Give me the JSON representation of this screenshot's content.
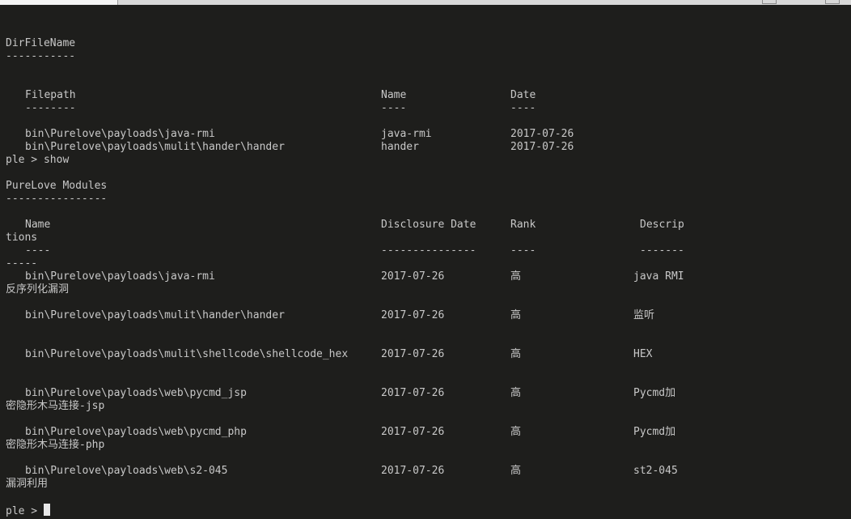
{
  "dirfile": {
    "heading": "DirFileName",
    "underline": "-----------",
    "columns": {
      "filepath": "Filepath",
      "name": "Name",
      "date": "Date"
    },
    "dashes": {
      "filepath": "--------",
      "name": "----",
      "date": "----"
    },
    "rows": [
      {
        "filepath": "bin\\Purelove\\payloads\\java-rmi",
        "name": "java-rmi",
        "date": "2017-07-26"
      },
      {
        "filepath": "bin\\Purelove\\payloads\\mulit\\hander\\hander",
        "name": "hander",
        "date": "2017-07-26"
      }
    ]
  },
  "show_command": "ple > show",
  "modules": {
    "heading": "PureLove Modules",
    "underline": "----------------",
    "columns": {
      "name": "Name",
      "date": "Disclosure Date",
      "rank": "Rank",
      "desc": "Descrip",
      "desc_wrap": "tions"
    },
    "dashes": {
      "name": "----",
      "date": "---------------",
      "rank": "----",
      "desc": "-------",
      "desc_wrap": "-----"
    },
    "rows": [
      {
        "name": "bin\\Purelove\\payloads\\java-rmi",
        "date": "2017-07-26",
        "rank": "高",
        "desc": "java RMI",
        "desc_wrap": "反序列化漏洞"
      },
      {
        "name": "bin\\Purelove\\payloads\\mulit\\hander\\hander",
        "date": "2017-07-26",
        "rank": "高",
        "desc": "监听",
        "desc_wrap": ""
      },
      {
        "name": "bin\\Purelove\\payloads\\mulit\\shellcode\\shellcode_hex",
        "date": "2017-07-26",
        "rank": "高",
        "desc": "HEX",
        "desc_wrap": ""
      },
      {
        "name": "bin\\Purelove\\payloads\\web\\pycmd_jsp",
        "date": "2017-07-26",
        "rank": "高",
        "desc": "Pycmd加",
        "desc_wrap": "密隐形木马连接-jsp"
      },
      {
        "name": "bin\\Purelove\\payloads\\web\\pycmd_php",
        "date": "2017-07-26",
        "rank": "高",
        "desc": "Pycmd加",
        "desc_wrap": "密隐形木马连接-php"
      },
      {
        "name": "bin\\Purelove\\payloads\\web\\s2-045",
        "date": "2017-07-26",
        "rank": "高",
        "desc": "st2-045",
        "desc_wrap": "漏洞利用"
      }
    ]
  },
  "prompt": "ple > ",
  "colors": {
    "background": "#1e1e1c",
    "text": "#c8c8c8",
    "cursor": "#e8e8e8"
  }
}
